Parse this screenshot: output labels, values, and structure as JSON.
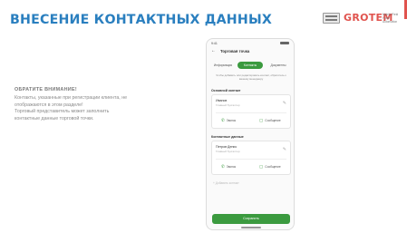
{
  "slide": {
    "title": "ВНЕСЕНИЕ КОНТАКТНЫХ ДАННЫХ",
    "title_color": "#2a7fbf",
    "accent_color": "#e0534e"
  },
  "logo": {
    "word": "GROTEM",
    "subtitle": "Mobile Field Force Automation"
  },
  "note": {
    "heading": "ОБРАТИТЕ ВНИМАНИЕ!",
    "lines": [
      "Контакты, указанные при регистрации клиента, не",
      "отображаются в этом разделе!",
      "Торговый представитель может заполнить",
      "контактные данные торговой точки."
    ]
  },
  "phone": {
    "title": "Торговая точка",
    "tabs": [
      "Информация",
      "Контакты",
      "Документы"
    ],
    "active_tab": 1,
    "hint": "Чтобы добавить или редактировать контакт, обратитесь к вашему менеджеру",
    "sections": [
      {
        "label": "Основной контакт",
        "name": "Иванов",
        "role": "Главный бухгалтер",
        "call": "Звонок",
        "message": "Сообщение"
      },
      {
        "label": "Контактные данные",
        "name": "Петров Денис",
        "role": "Главный бухгалтер",
        "call": "Звонок",
        "message": "Сообщение"
      }
    ],
    "add_contact": "+ Добавить контакт",
    "save": "Сохранить"
  }
}
